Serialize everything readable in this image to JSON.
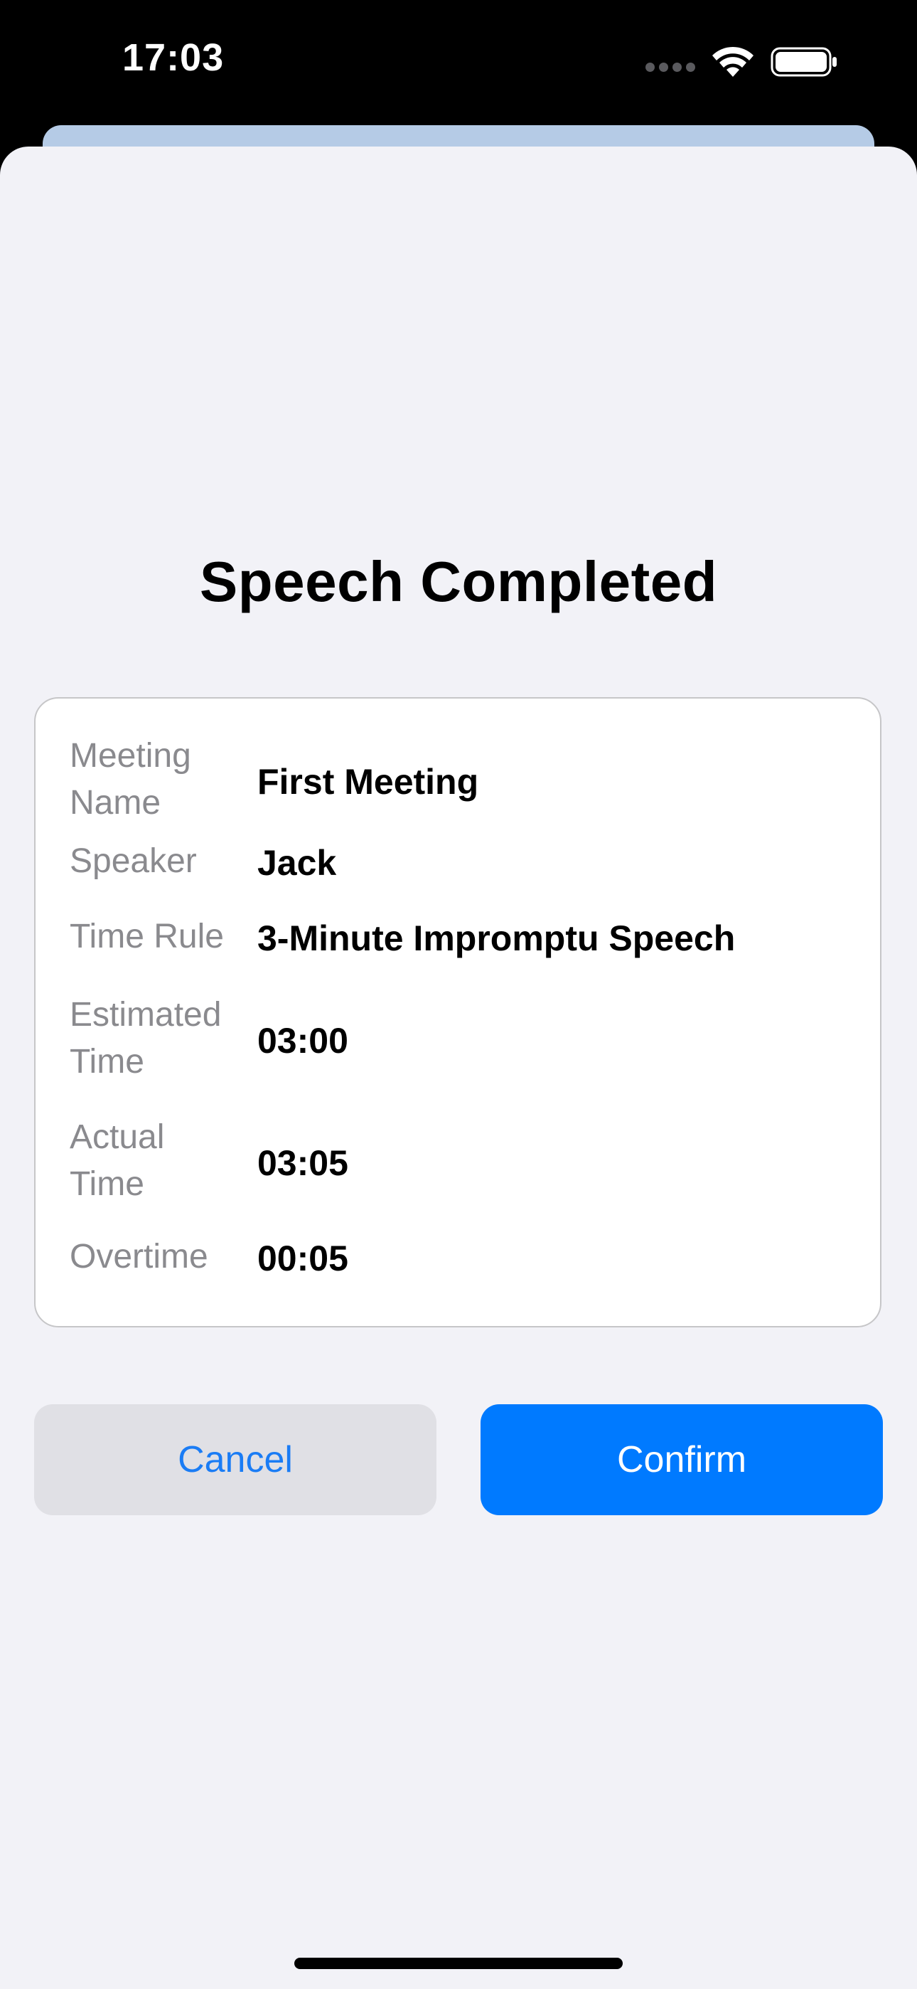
{
  "status_bar": {
    "time": "17:03",
    "icons": [
      "cellular-signal-icon",
      "wifi-icon",
      "battery-icon"
    ]
  },
  "sheet": {
    "title": "Speech Completed",
    "details": [
      {
        "label": "Meeting Name",
        "value": "First Meeting"
      },
      {
        "label": "Speaker",
        "value": "Jack"
      },
      {
        "label": "Time Rule",
        "value": "3-Minute Impromptu Speech"
      },
      {
        "label": "Estimated Time",
        "value": "03:00"
      },
      {
        "label": "Actual Time",
        "value": "03:05"
      },
      {
        "label": "Overtime",
        "value": "00:05"
      }
    ],
    "buttons": {
      "cancel": "Cancel",
      "confirm": "Confirm"
    }
  },
  "colors": {
    "accent": "#007aff",
    "sheet_background": "#f2f2f7",
    "label_gray": "#8a8a8e",
    "cancel_background": "#e0e0e5"
  }
}
